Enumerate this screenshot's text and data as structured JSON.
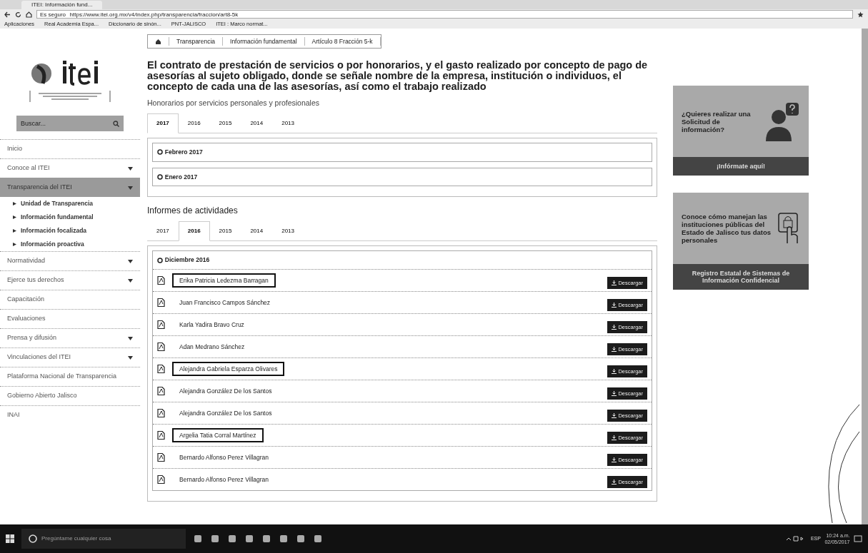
{
  "browser": {
    "tab_title": "ITEI: Información fund...",
    "secure_label": "Es seguro",
    "url": "https://www.itei.org.mx/v4/index.php/transparencia/fraccion/art8-5k",
    "bookmarks": [
      "Aplicaciones",
      "Real Academia Espa...",
      "Diccionario de sinón...",
      "PNT-JALISCO",
      "ITEI : Marco normat..."
    ]
  },
  "breadcrumb": [
    "Transparencia",
    "Información fundamental",
    "Artículo 8 Fracción 5-k"
  ],
  "sidebar": {
    "search_placeholder": "Buscar...",
    "items": [
      {
        "label": "Inicio",
        "has_submenu": false,
        "expanded": false
      },
      {
        "label": "Conoce al ITEI",
        "has_submenu": true,
        "expanded": false
      },
      {
        "label": "Transparencia del ITEI",
        "has_submenu": true,
        "expanded": true,
        "children": [
          "Unidad de Transparencia",
          "Información fundamental",
          "Información focalizada",
          "Información proactiva"
        ]
      },
      {
        "label": "Normatividad",
        "has_submenu": true,
        "expanded": false
      },
      {
        "label": "Ejerce tus derechos",
        "has_submenu": true,
        "expanded": false
      },
      {
        "label": "Capacitación",
        "has_submenu": false,
        "expanded": false
      },
      {
        "label": "Evaluaciones",
        "has_submenu": false,
        "expanded": false
      },
      {
        "label": "Prensa y difusión",
        "has_submenu": true,
        "expanded": false
      },
      {
        "label": "Vinculaciones del ITEI",
        "has_submenu": true,
        "expanded": false
      },
      {
        "label": "Plataforma Nacional de Transparencia",
        "has_submenu": false,
        "expanded": false
      },
      {
        "label": "Gobierno Abierto Jalisco",
        "has_submenu": false,
        "expanded": false
      },
      {
        "label": "INAI",
        "has_submenu": false,
        "expanded": false
      }
    ]
  },
  "main": {
    "title": "El contrato de prestación de servicios o por honorarios, y el gasto realizado por concepto de pago de asesorías al sujeto obligado, donde se señale nombre de la empresa, institución o individuos, el concepto de cada una de las asesorías, así como el trabajo realizado",
    "sections": [
      {
        "heading": "Honorarios por servicios personales y profesionales",
        "tabs": [
          {
            "label": "2017",
            "selected": true
          },
          {
            "label": "2016",
            "selected": false
          },
          {
            "label": "2015",
            "selected": false
          },
          {
            "label": "2014",
            "selected": false
          },
          {
            "label": "2013",
            "selected": false
          }
        ],
        "groups": [
          {
            "title": "Febrero 2017"
          },
          {
            "title": "Enero 2017"
          }
        ]
      },
      {
        "heading": "Informes de actividades",
        "tabs": [
          {
            "label": "2017",
            "selected": false
          },
          {
            "label": "2016",
            "selected": true
          },
          {
            "label": "2015",
            "selected": false
          },
          {
            "label": "2014",
            "selected": false
          },
          {
            "label": "2013",
            "selected": false
          }
        ],
        "groups": [
          {
            "title": "Diciembre 2016",
            "files": [
              {
                "name": "Erika Patricia Ledezma Barragan",
                "marked": true,
                "button": "Descargar"
              },
              {
                "name": "Juan Francisco Campos Sánchez",
                "marked": false,
                "button": "Descargar"
              },
              {
                "name": "Karla Yadira Bravo Cruz",
                "marked": false,
                "button": "Descargar"
              },
              {
                "name": "Adan Medrano Sánchez",
                "marked": false,
                "button": "Descargar"
              },
              {
                "name": "Alejandra Gabriela Esparza Olivares",
                "marked": true,
                "button": "Descargar"
              },
              {
                "name": "Alejandra González De los Santos",
                "marked": false,
                "button": "Descargar"
              },
              {
                "name": "Alejandra González De los Santos",
                "marked": false,
                "button": "Descargar"
              },
              {
                "name": "Argelia Tatia Corral Martínez",
                "marked": true,
                "button": "Descargar"
              },
              {
                "name": "Bernardo Alfonso Perez Villagran",
                "marked": false,
                "button": "Descargar"
              },
              {
                "name": "Bernardo Alfonso Perez Villagran",
                "marked": false,
                "button": "Descargar"
              }
            ]
          }
        ]
      }
    ]
  },
  "promos": [
    {
      "kind": "person",
      "text": "¿Quieres realizar una Solicitud de información?",
      "link": "¡Infórmate aquí!"
    },
    {
      "kind": "lock",
      "text": "Conoce cómo manejan las instituciones públicas del Estado de Jalisco tus datos personales",
      "link": "Registro Estatal de Sistemas de Información Confidencial"
    }
  ],
  "taskbar": {
    "search_placeholder": "Pregúntame cualquier cosa",
    "language": "ESP",
    "time": "10:24 a.m.",
    "date": "02/05/2017"
  }
}
